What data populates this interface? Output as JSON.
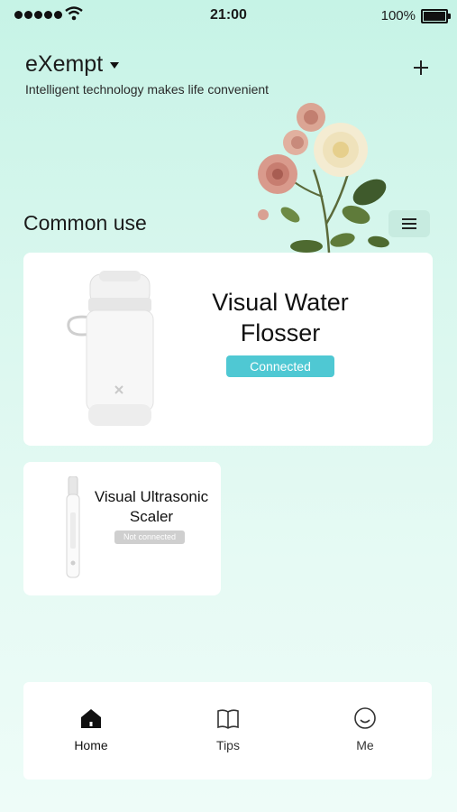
{
  "status_bar": {
    "time": "21:00",
    "battery": "100%"
  },
  "header": {
    "home_name": "eXempt",
    "tagline": "Intelligent  technology makes life convenient"
  },
  "section": {
    "title": "Common use"
  },
  "devices": [
    {
      "name_line1": "Visual Water",
      "name_line2": "Flosser",
      "status": "Connected",
      "status_color": "#4fc8d3"
    },
    {
      "name_line1": "Visual Ultrasonic",
      "name_line2": "Scaler",
      "status": "Not connected",
      "status_color": "#cfcfcf"
    }
  ],
  "nav": [
    {
      "label": "Home",
      "icon": "home-icon",
      "active": true
    },
    {
      "label": "Tips",
      "icon": "book-icon",
      "active": false
    },
    {
      "label": "Me",
      "icon": "smile-icon",
      "active": false
    }
  ],
  "colors": {
    "accent": "#4fc8d3",
    "background": "#d9f7ee"
  }
}
